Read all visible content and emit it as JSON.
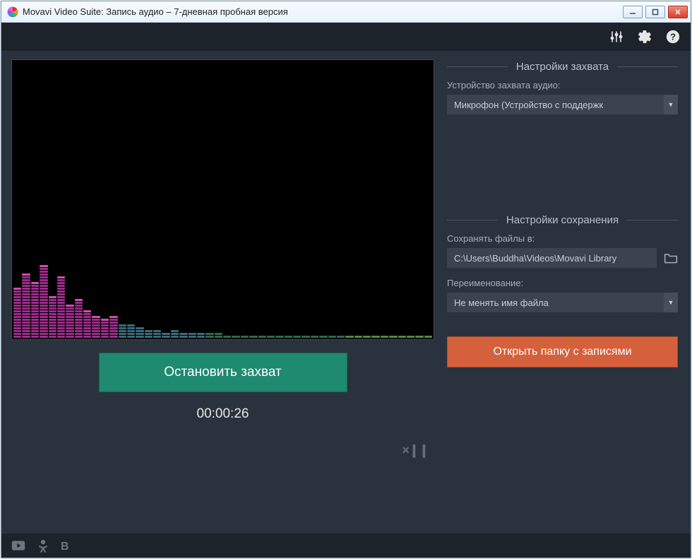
{
  "window": {
    "title": "Movavi Video Suite: Запись аудио – 7-дневная пробная версия"
  },
  "main": {
    "stop_label": "Остановить захват",
    "timer": "00:00:26",
    "mute_symbol": "×❙❙"
  },
  "capture": {
    "section_title": "Настройки захвата",
    "device_label": "Устройство захвата аудио:",
    "device_value": "Микрофон (Устройство с поддержк"
  },
  "saving": {
    "section_title": "Настройки сохранения",
    "save_to_label": "Сохранять файлы в:",
    "save_path": "C:\\Users\\Buddha\\Videos\\Movavi Library",
    "rename_label": "Переименование:",
    "rename_value": "Не менять имя файла",
    "open_folder_label": "Открыть папку с записями"
  },
  "viz_heights": [
    18,
    23,
    20,
    26,
    15,
    22,
    12,
    14,
    10,
    8,
    7,
    8,
    5,
    5,
    4,
    3,
    3,
    2,
    3,
    2,
    2,
    2,
    2,
    2,
    1,
    1,
    1,
    1,
    1,
    1,
    1,
    1,
    1,
    1,
    1,
    1,
    1,
    1,
    1,
    1,
    1,
    1,
    1,
    1,
    1,
    1,
    1,
    1
  ]
}
